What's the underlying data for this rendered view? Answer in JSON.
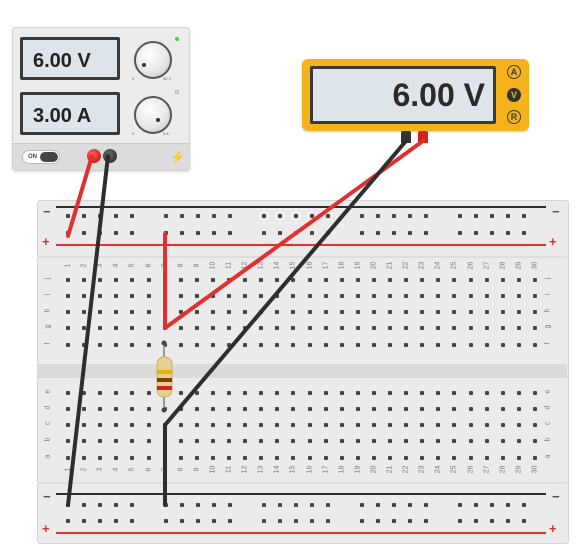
{
  "power_supply": {
    "voltage_display": "6.00 V",
    "current_display": "3.00 A",
    "on_label": "ON",
    "voltage_knob_min": "0",
    "voltage_knob_max": "30 V",
    "current_knob_min": "0",
    "current_knob_max": "5 A",
    "indicator_color": "#3bd23b"
  },
  "multimeter": {
    "display": "6.00 V",
    "modes": [
      "A",
      "V",
      "R"
    ],
    "active_mode": "V",
    "body_color": "#f4b31c"
  },
  "breadboard": {
    "rail_minus": "−",
    "rail_plus": "+",
    "row_labels_top": [
      "j",
      "i",
      "h",
      "g",
      "f"
    ],
    "row_labels_bottom": [
      "e",
      "d",
      "c",
      "b",
      "a"
    ],
    "columns": [
      "1",
      "2",
      "3",
      "4",
      "5",
      "6",
      "7",
      "8",
      "9",
      "10",
      "11",
      "12",
      "13",
      "14",
      "15",
      "16",
      "17",
      "18",
      "19",
      "20",
      "21",
      "22",
      "23",
      "24",
      "25",
      "26",
      "27",
      "28",
      "29",
      "30"
    ]
  },
  "resistor": {
    "bands": [
      "#e0b400",
      "#7b3f00",
      "#d32020"
    ]
  },
  "wire_colors": {
    "red": "#e13030",
    "black": "#2e2e2e"
  }
}
